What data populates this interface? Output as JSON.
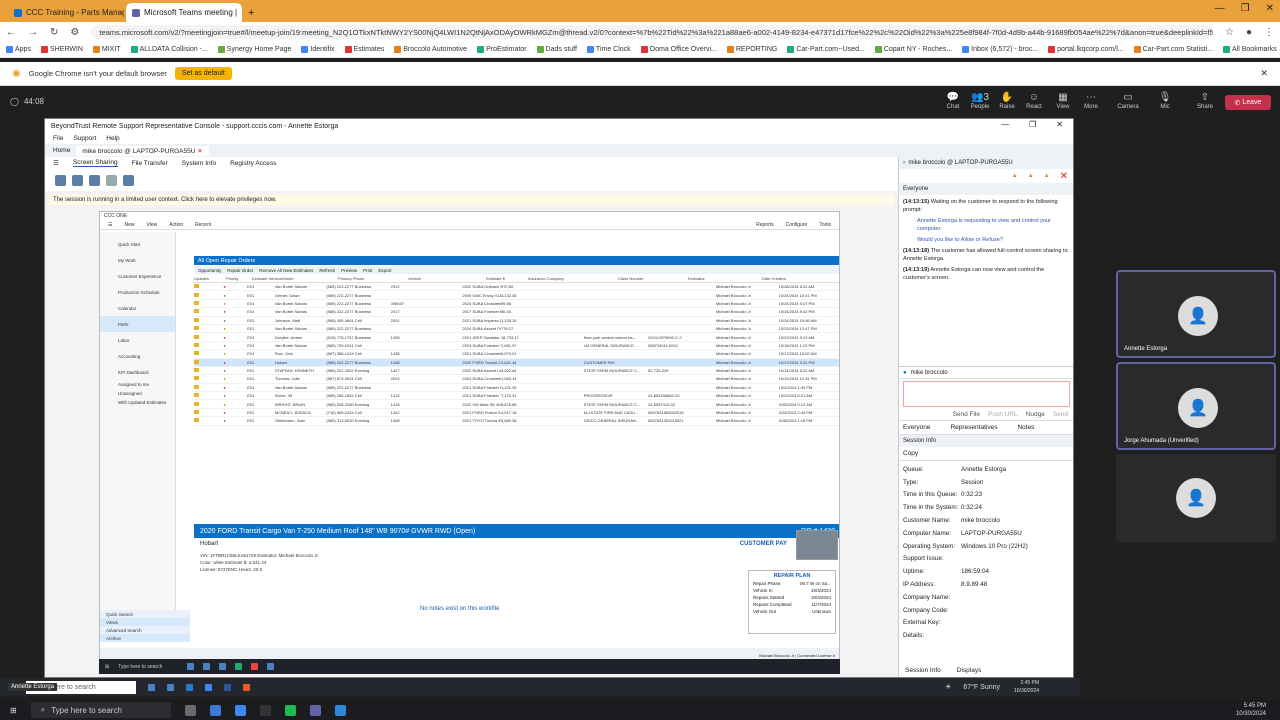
{
  "browser": {
    "tabs": [
      {
        "label": "CCC Training - Parts Managem...",
        "active": false
      },
      {
        "label": "Microsoft Teams meeting |",
        "active": true
      }
    ],
    "url": "teams.microsoft.com/v2/?meetingjoin=true#/l/meetup-join/19:meeting_N2Q1OTkxNTktNWY2YS00NjQ4LWI1N2QtNjAxODAyOWRkMGZm@thread.v2/0?context=%7b%22Tid%22%3a%221a88ae6-a002-4149-8234-e47371d17fce%22%2c%22Oid%22%3a%225e8f984f-7f0d-4d9b-a44b-91689fb054ae%22%7d&anon=true&deeplinkId=f5745c43-189b-4cb0-ba1f-5f719b5cfd98",
    "bookmarks": [
      "Apps",
      "SHERWIN",
      "MIXIT",
      "ALLDATA Collision -...",
      "Synergy Home Page",
      "Identifix",
      "Estimates",
      "Broccolo Automotive",
      "ProEstimator",
      "Dads stuff",
      "Time Clock",
      "Ooma Office Overvi...",
      "REPORTING",
      "Car-Part.com--Used...",
      "Copart NY - Roches...",
      "Inbox (6,572) - broc...",
      "portal.lkqcorp.com/l...",
      "Car-Part.com Statisti...",
      "All Bookmarks"
    ],
    "infobar_text": "Google Chrome isn't your default browser",
    "infobar_button": "Set as default"
  },
  "teams": {
    "timer": "44:08",
    "toolbar": [
      {
        "label": "Chat",
        "icon": "chat-icon",
        "glyph": "💬"
      },
      {
        "label": "People",
        "icon": "people-icon",
        "glyph": "👥",
        "count": "3"
      },
      {
        "label": "Raise",
        "icon": "raise-hand-icon",
        "glyph": "✋"
      },
      {
        "label": "React",
        "icon": "react-icon",
        "glyph": "☺"
      },
      {
        "label": "View",
        "icon": "view-icon",
        "glyph": "▦"
      },
      {
        "label": "More",
        "icon": "more-icon",
        "glyph": "⋯"
      },
      {
        "label": "Camera",
        "icon": "camera-icon",
        "glyph": "▭"
      },
      {
        "label": "Mic",
        "icon": "mic-icon",
        "glyph": "🎙"
      },
      {
        "label": "Share",
        "icon": "share-icon",
        "glyph": "⇧"
      }
    ],
    "leave_label": "Leave",
    "participants": [
      {
        "name": "Annette Estorga",
        "highlight": true
      },
      {
        "name": "Jorge Ahumada (Unverified)",
        "highlight": true
      },
      {
        "name": "",
        "highlight": false
      }
    ]
  },
  "remote": {
    "title": "BeyondTrust Remote Support Representative Console - support.cccis.com - Annette Estorga",
    "menu": [
      "File",
      "Support",
      "Help"
    ],
    "home_tab": "Home",
    "session_tab": "mike broccolo @ LAPTOP-PURGA55U",
    "tabs": [
      "Screen Sharing",
      "File Transfer",
      "System Info",
      "Registry Access"
    ],
    "notice": "The session is running in a limited user context.  Click here to elevate privileges now.",
    "right_header": "mike broccolo @ LAPTOP-PURGA55U",
    "chat_header": "Everyone",
    "chat": [
      {
        "time": "(14:13:15)",
        "text": "Waiting on the customer to respond to the following prompt:"
      },
      {
        "time": "",
        "text": "Annette Estorga is requesting to view and control your computer."
      },
      {
        "time": "",
        "text": "Would you like to Allow or Refuse?"
      },
      {
        "time": "(14:13:18)",
        "text": "The customer has allowed full-control screen sharing to Annette Estorga."
      },
      {
        "time": "(14:13:19)",
        "text": "Annette Estorga can now view and control the customer's screen."
      }
    ],
    "chat_user": "mike broccolo",
    "chat_actions": [
      "Send File",
      "Push URL",
      "Nudge",
      "Send"
    ],
    "chat_tabs": [
      "Everyone",
      "Representatives",
      "Notes"
    ],
    "session_info_header": "Session Info",
    "copy_label": "Copy",
    "session_info": [
      {
        "k": "Queue:",
        "v": "Annette Estorga"
      },
      {
        "k": "Type:",
        "v": "Session"
      },
      {
        "k": "Time in this Queue:",
        "v": "0:32:23"
      },
      {
        "k": "Time in the System:",
        "v": "0:32:24"
      },
      {
        "k": "Customer Name:",
        "v": "mike broccolo"
      },
      {
        "k": "Computer Name:",
        "v": "LAPTOP-PURGA55U"
      },
      {
        "k": "Operating System:",
        "v": "Windows 10 Pro (22H2)"
      },
      {
        "k": "Support Issue:",
        "v": ""
      },
      {
        "k": "Uptime:",
        "v": "186:59:04"
      },
      {
        "k": "IP Address:",
        "v": "8.9.89.48"
      },
      {
        "k": "Company Name:",
        "v": ""
      },
      {
        "k": "Company Code:",
        "v": ""
      },
      {
        "k": "External Key:",
        "v": ""
      },
      {
        "k": "Details:",
        "v": ""
      }
    ],
    "bottom_tabs": [
      "Session Info",
      "Displays"
    ]
  },
  "ccc": {
    "app": "CCC ONE",
    "menu": [
      "New",
      "View",
      "Action",
      "Recent",
      "Reports",
      "Configure",
      "Tools"
    ],
    "side": [
      "Quick Start",
      "My Work",
      "Customer Experience",
      "Production Schedule",
      "Calendar",
      "Parts",
      "Labor",
      "Accounting",
      "KPI Dashboard"
    ],
    "side_sub": [
      "Assigned to me",
      "Unassigned",
      "With Updated Estimates"
    ],
    "side_bottom": [
      "Quick Search",
      "Views",
      "Advanced Search",
      "Archive"
    ],
    "orders_title": "All Open Repair Orders",
    "orders_tools": [
      "Opportunity",
      "Repair Order",
      "Remove All New Estimates",
      "Refresh",
      "Preview",
      "Print",
      "Export"
    ],
    "columns": [
      "Updates",
      "Priority",
      "Estimate Version",
      "Owner",
      "Primary Phone",
      "Vehicle",
      "Estimate $",
      "Insurance Company",
      "Claim Number",
      "Estimator",
      "Date Created"
    ],
    "rows": [
      [
        "E01",
        "Van Bortel Subaru",
        "(585) 222-2277 Business",
        "2012",
        "2022 SUBA Outback Wild...",
        "970.50",
        "",
        "",
        "Michael Broccolo Jr",
        "10/28/2024 8:22 AM"
      ],
      [
        "E01",
        "Gerber, Dawn",
        "(585) 222-2277 Business",
        "",
        "2009 GMC Envoy SLE1 Ut...",
        "3,132.06",
        "",
        "",
        "Michael Broccolo Jr",
        "10/24/2024 10:41 PM"
      ],
      [
        "E01",
        "Van Bortel Subaru",
        "(585) 222-2277 Business",
        "008047",
        "2024 SUBA Crosstrek Pr...",
        "95.66",
        "",
        "",
        "Michael Broccolo Jr",
        "10/24/2024 5:47 PM"
      ],
      [
        "E01",
        "Van Bortel Subaru",
        "(585) 222-2277 Business",
        "2017",
        "2017 SUBA Forester Pr...",
        "80.00",
        "",
        "",
        "Michael Broccolo Jr",
        "10/24/2024 5:42 PM"
      ],
      [
        "E01",
        "Johnson, Matt",
        "(585) 455-4661 Cell",
        "2001",
        "2021 SUBA Impreza Wag...",
        "1,133.15",
        "",
        "",
        "Michael Broccolo Jr",
        "10/24/2024 10:56 AM"
      ],
      [
        "E01",
        "Van Bortel Subaru",
        "(585) 222-2277 Business",
        "",
        "2024 SUBA Ascent Prem...",
        "778.27",
        "",
        "",
        "Michael Broccolo Jr",
        "10/23/2024 12:47 PM"
      ],
      [
        "E01",
        "Dorytke, Amber",
        "(315) 778-1757 Business",
        "1458",
        "2021 JEEP Gladiator Rub...",
        "18,733.17",
        "New york central mutual ins...",
        "2024-0375990-C-2",
        "Michael Broccolo Jr",
        "10/23/2024 9:12 AM"
      ],
      [
        "E01",
        "Van Bortel Subaru",
        "(585) 739-2241 Cell",
        "",
        "2024 SUBA Forester Tou...",
        "2,981.97",
        "LM GENERAL INSURANCE ...",
        "058734011-0001",
        "Michael Broccolo Jr",
        "10/18/2024 1:22 PM"
      ],
      [
        "E01",
        "Ruiz, Zein",
        "(587) 388-1419 Cell",
        "1438",
        "2021 SUBA Crosstrek Li...",
        "6,973.01",
        "",
        "",
        "Michael Broccolo Jr",
        "10/17/2024 10:02 AM"
      ],
      [
        "E01",
        "Hobart",
        "(585) 222-2277 Business",
        "1438",
        "2020 FORD Transit Carg...",
        "3,641.44",
        "CUSTOMER PAY",
        "",
        "Michael Broccolo Jr",
        "10/17/2024 3:31 PM"
      ],
      [
        "E01",
        "STAFFAN, KENNETH",
        "(585) 202-4302 Evening",
        "1427",
        "2022 SUBA Ascent Limit...",
        "4,002.64",
        "STATE FARM INSURANCE C...",
        "52-729-229",
        "Michael Broccolo Jr",
        "10/14/2024 8:22 AM"
      ],
      [
        "E01",
        "Thomas, Julie",
        "(587) 873-3531 Cell",
        "2024",
        "2024 SUBA Crosstrek Pr...",
        "1,060.14",
        "",
        "",
        "Michael Broccolo Jr",
        "10/10/2024 12:31 PM"
      ],
      [
        "E01",
        "Van Bortel Subaru",
        "(585) 222-2277 Business",
        "",
        "2021 SUBA Forester Pr...",
        "1,131.39",
        "",
        "",
        "Michael Broccolo Jr",
        "10/4/2024 1:49 PM"
      ],
      [
        "E01",
        "Stone, Jill",
        "(585) 266-1652 Cell",
        "1415",
        "2021 SUBA Forester To...",
        "7,170.31",
        "PROGRESSIVE",
        "24-883158662-02",
        "Michael Broccolo Jr",
        "10/2/2024 8:21 AM"
      ],
      [
        "E01",
        "WRIGHT, BRIAN",
        "(585) 528-2280 Evening",
        "1418",
        "2022 VW Atlas SE 4MOTI...",
        "8,876.66",
        "STATE FARM INSURANCE C...",
        "24-5557415-02",
        "Michael Broccolo Jr",
        "9/25/2024 9:12 AM"
      ],
      [
        "E01",
        "MCNEILY, JESSICA",
        "(716) 465-2434 Cell",
        "1422",
        "2021 FORD Fusion SE F...",
        "4,917.16",
        "ALLSTATE FIRE AND CASU...",
        "0697631854052015",
        "Michael Broccolo Jr",
        "9/24/2024 2:44 PM"
      ],
      [
        "E01",
        "Ohlbenden, John",
        "(585) 313-0030 Evening",
        "1408",
        "2021 TOYO Tundra 4WD...",
        "5,680.38",
        "GEICO GENERAL INSURAN...",
        "0637631051015021",
        "Michael Broccolo Jr",
        "9/18/2024 1:16 PM"
      ]
    ],
    "vehicle_title": "2020 FORD Transit Cargo Van T-250 Medium Roof 148\" WB 9070# GVWR RWD (Open)",
    "ro": "RO # 1438",
    "owner": "Hobart",
    "pay": "CUSTOMER PAY",
    "vehicle_info": [
      "VIN:  1FTBR1C85LKA61729     Estimator:  Michael Broccolo Jr",
      "Color:  white               Estimate $:  3,641.44",
      "License:  5727ENC           Hours:  20.8"
    ],
    "no_notes": "No notes exist on this workfile",
    "repair_plan": {
      "title": "REPAIR PLAN",
      "rows": [
        [
          "Repair Phase:",
          "00.7 W on Su..."
        ],
        [
          "Vehicle In",
          "10/3/2024"
        ],
        [
          "Repairs Started",
          "10/3/2024"
        ],
        [
          "Repairs Completed",
          "11/7/2024"
        ],
        [
          "Vehicle Out",
          "Unknown"
        ]
      ]
    },
    "footer": "Michael Broccolo Jr  |  Connected  License #"
  },
  "taskbars": {
    "viewer_search": "Type here to search",
    "viewer_weather": "67°F Sunny",
    "viewer_time": "2:45 PM",
    "viewer_date": "10/30/2024",
    "host_search": "Type here to search",
    "host_time": "5:45 PM",
    "host_date": "10/30/2024",
    "host_user": "Annette Estorga"
  }
}
